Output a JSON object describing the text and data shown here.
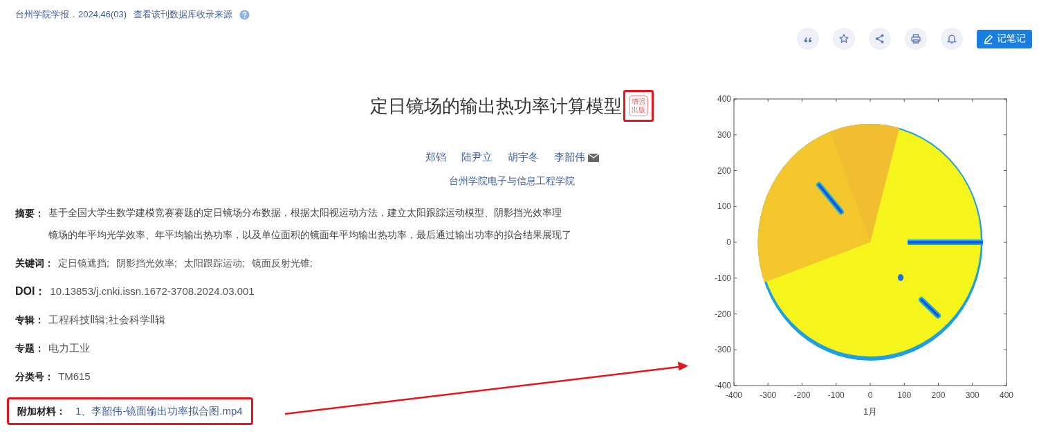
{
  "source": {
    "journal": "台州学院学报．2024,46(03)",
    "link": "查看该刊数据库收录来源"
  },
  "toolbar": {
    "icons": [
      {
        "kind": "quote"
      },
      {
        "kind": "star"
      },
      {
        "kind": "share"
      },
      {
        "kind": "print"
      },
      {
        "kind": "bell"
      }
    ],
    "note_button": "记笔记"
  },
  "article": {
    "title": "定日镜场的输出热功率计算模型",
    "badge": {
      "line_1": "增强",
      "line_2": "出版",
      "highlighted": true
    },
    "authors": [
      {
        "name": "郑铛",
        "email": false
      },
      {
        "name": "陆尹立",
        "email": false
      },
      {
        "name": "胡宇冬",
        "email": false
      },
      {
        "name": "李韶伟",
        "email": true
      }
    ],
    "affiliation": "台州学院电子与信息工程学院"
  },
  "fields": [
    {
      "kind": "abstract",
      "label": "摘要：",
      "lines": [
        "基于全国大学生数学建模竞赛赛题的定日镜场分布数据，根据太阳视运动方法，建立太阳跟踪运动模型、阴影挡光效率理",
        "镜场的年平均光学效率、年平均输出热功率，以及单位面积的镜面年平均输出热功率，最后通过输出功率的拟合结果展现了"
      ]
    },
    {
      "kind": "keywords",
      "label": "关键词：",
      "items": [
        "定日镜遮挡;",
        "阴影挡光效率;",
        "太阳跟踪运动;",
        "镜面反射光锥;"
      ]
    },
    {
      "kind": "doi",
      "label": "DOI：",
      "value": "10.13853/j.cnki.issn.1672-3708.2024.03.001"
    },
    {
      "kind": "text",
      "label": "专辑：",
      "value": "工程科技Ⅱ辑;社会科学Ⅱ辑"
    },
    {
      "kind": "text",
      "label": "专题：",
      "value": "电力工业"
    },
    {
      "kind": "text",
      "label": "分类号：",
      "value": "TM615"
    },
    {
      "kind": "link",
      "label": "附加材料：",
      "value": "1、李韶伟-镜面输出功率拟合图.mp4",
      "highlighted": true
    }
  ],
  "figure": {
    "yticks": [
      "400",
      "300",
      "200",
      "100",
      "0",
      "-100",
      "-200",
      "-300",
      "-400"
    ],
    "xticks": [
      "-400",
      "-300",
      "-200",
      "-100",
      "0",
      "100",
      "200",
      "300",
      "400"
    ],
    "xlabel": "1月"
  },
  "annotation": {
    "arrow": true
  }
}
